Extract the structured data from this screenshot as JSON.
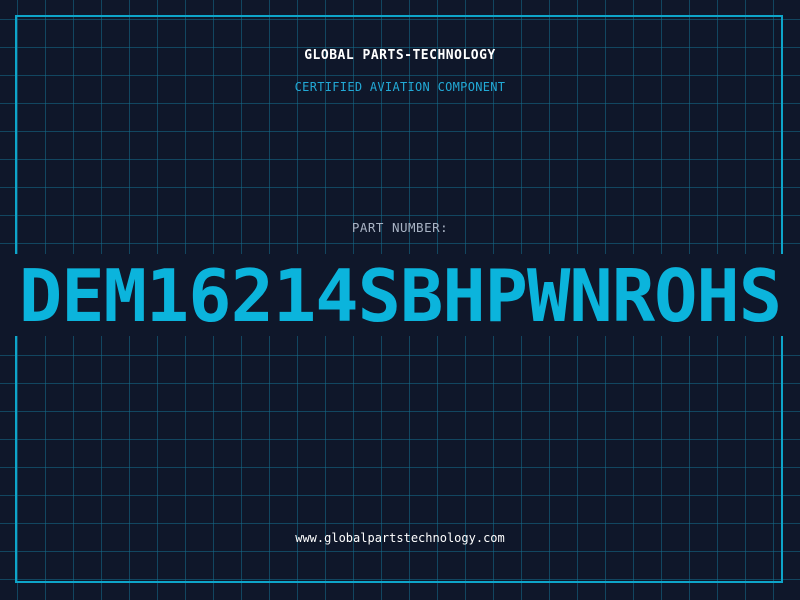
{
  "header": {
    "company": "GLOBAL PARTS-TECHNOLOGY",
    "subtitle": "CERTIFIED AVIATION COMPONENT"
  },
  "part": {
    "label": "PART NUMBER:",
    "number": "DEM16214SBHPWNROHS"
  },
  "footer": {
    "url": "www.globalpartstechnology.com"
  },
  "colors": {
    "background": "#0f172a",
    "grid": "#146e8c",
    "accent": "#0bb4dc",
    "frame": "#0ea5c9"
  }
}
